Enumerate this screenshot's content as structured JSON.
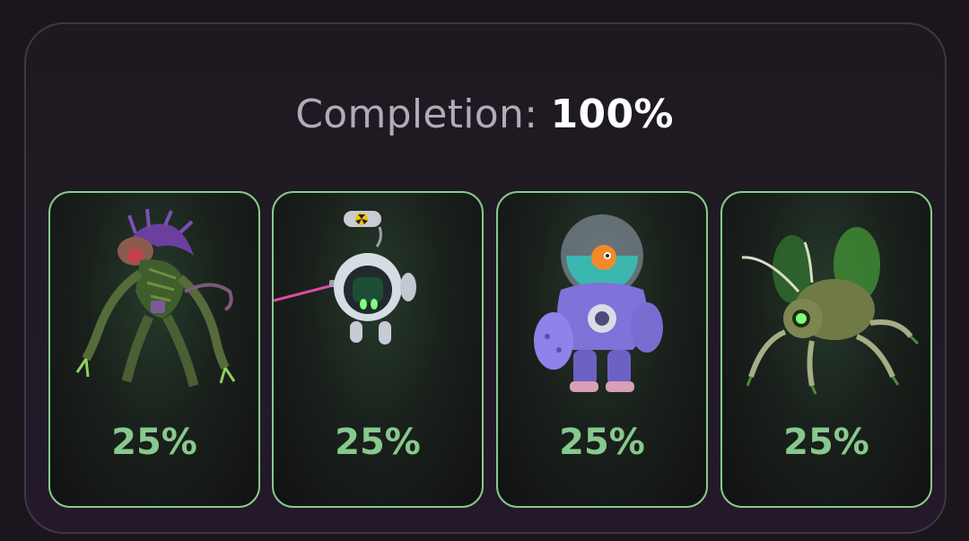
{
  "completion": {
    "label": "Completion:",
    "value": "100%"
  },
  "cards": [
    {
      "icon": "mutant-beast-icon",
      "percent": "25%"
    },
    {
      "icon": "robot-drone-icon",
      "percent": "25%"
    },
    {
      "icon": "armored-astronaut-icon",
      "percent": "25%"
    },
    {
      "icon": "mech-bug-icon",
      "percent": "25%"
    }
  ],
  "colors": {
    "accent_green": "#86c98d",
    "panel_border": "#3f3744",
    "label_gray": "#b3a9b7",
    "value_white": "#ffffff"
  }
}
